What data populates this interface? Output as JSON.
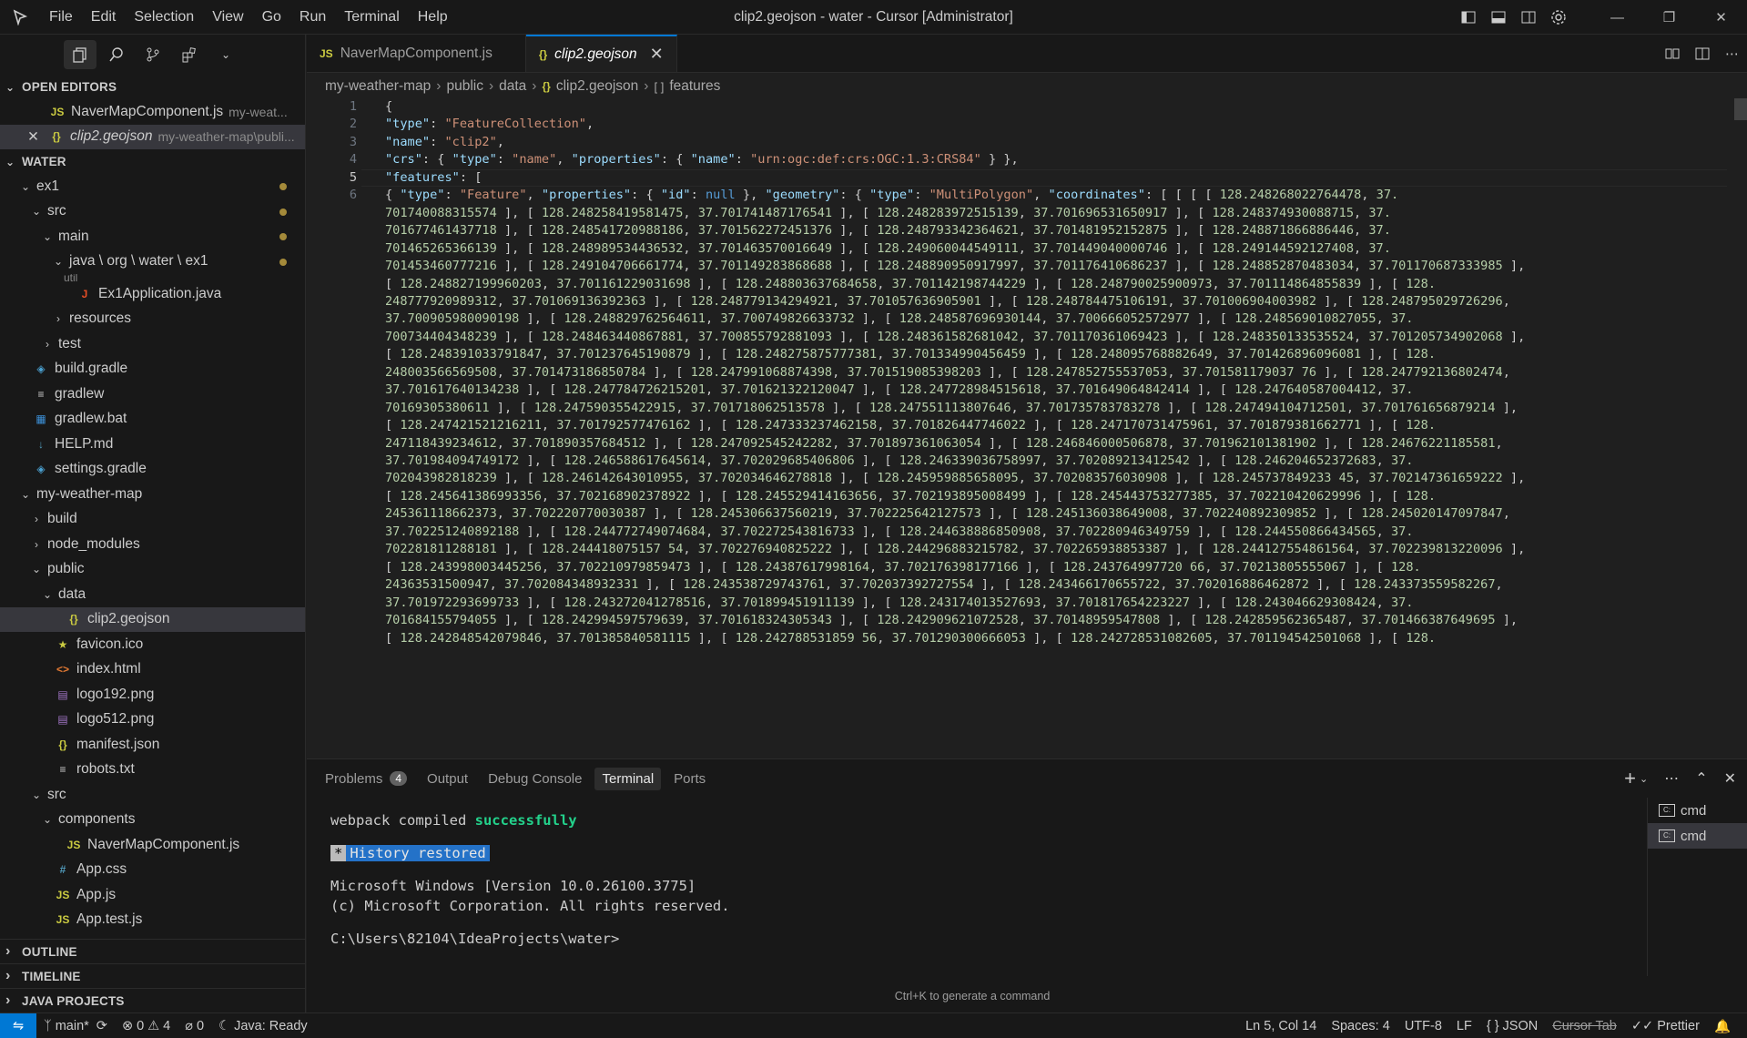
{
  "window": {
    "title": "clip2.geojson - water - Cursor [Administrator]",
    "menu": [
      "File",
      "Edit",
      "Selection",
      "View",
      "Go",
      "Run",
      "Terminal",
      "Help"
    ]
  },
  "sidebar": {
    "open_editors_title": "OPEN EDITORS",
    "open_editors": [
      {
        "icon": "JS",
        "name": "NaverMapComponent.js",
        "desc": "my-weat..."
      },
      {
        "icon": "{}",
        "name": "clip2.geojson",
        "desc": "my-weather-map\\publi..."
      }
    ],
    "workspace_title": "WATER",
    "tree": [
      {
        "label": "ex1",
        "depth": 1,
        "twisty": "open",
        "icon": "",
        "modified": true
      },
      {
        "label": "src",
        "depth": 2,
        "twisty": "open",
        "icon": "",
        "modified": true
      },
      {
        "label": "main",
        "depth": 3,
        "twisty": "open",
        "icon": "",
        "modified": true
      },
      {
        "label": "java \\ org \\ water \\ ex1",
        "depth": 4,
        "twisty": "open",
        "icon": "",
        "modified": true
      },
      {
        "label": "Ex1Application.java",
        "depth": 5,
        "twisty": "",
        "icon": "J",
        "modified": false
      },
      {
        "label": "resources",
        "depth": 4,
        "twisty": "closed",
        "icon": "",
        "modified": false
      },
      {
        "label": "test",
        "depth": 3,
        "twisty": "closed",
        "icon": "",
        "modified": false
      },
      {
        "label": "build.gradle",
        "depth": 1,
        "twisty": "",
        "icon": "gradle",
        "modified": false
      },
      {
        "label": "gradlew",
        "depth": 1,
        "twisty": "",
        "icon": "lines",
        "modified": false
      },
      {
        "label": "gradlew.bat",
        "depth": 1,
        "twisty": "",
        "icon": "win",
        "modified": false
      },
      {
        "label": "HELP.md",
        "depth": 1,
        "twisty": "",
        "icon": "md",
        "modified": false
      },
      {
        "label": "settings.gradle",
        "depth": 1,
        "twisty": "",
        "icon": "gradle",
        "modified": false
      },
      {
        "label": "my-weather-map",
        "depth": 1,
        "twisty": "open",
        "icon": "",
        "modified": false
      },
      {
        "label": "build",
        "depth": 2,
        "twisty": "closed",
        "icon": "",
        "modified": false
      },
      {
        "label": "node_modules",
        "depth": 2,
        "twisty": "closed",
        "icon": "",
        "modified": false
      },
      {
        "label": "public",
        "depth": 2,
        "twisty": "open",
        "icon": "",
        "modified": false
      },
      {
        "label": "data",
        "depth": 3,
        "twisty": "open",
        "icon": "",
        "modified": false
      },
      {
        "label": "clip2.geojson",
        "depth": 4,
        "twisty": "",
        "icon": "{}",
        "modified": false,
        "selected": true
      },
      {
        "label": "favicon.ico",
        "depth": 3,
        "twisty": "",
        "icon": "star",
        "modified": false
      },
      {
        "label": "index.html",
        "depth": 3,
        "twisty": "",
        "icon": "html",
        "modified": false
      },
      {
        "label": "logo192.png",
        "depth": 3,
        "twisty": "",
        "icon": "img",
        "modified": false
      },
      {
        "label": "logo512.png",
        "depth": 3,
        "twisty": "",
        "icon": "img",
        "modified": false
      },
      {
        "label": "manifest.json",
        "depth": 3,
        "twisty": "",
        "icon": "{}",
        "modified": false
      },
      {
        "label": "robots.txt",
        "depth": 3,
        "twisty": "",
        "icon": "lines",
        "modified": false
      },
      {
        "label": "src",
        "depth": 2,
        "twisty": "open",
        "icon": "",
        "modified": false
      },
      {
        "label": "components",
        "depth": 3,
        "twisty": "open",
        "icon": "",
        "modified": false
      },
      {
        "label": "NaverMapComponent.js",
        "depth": 4,
        "twisty": "",
        "icon": "JS",
        "modified": false
      },
      {
        "label": "App.css",
        "depth": 3,
        "twisty": "",
        "icon": "#",
        "modified": false
      },
      {
        "label": "App.js",
        "depth": 3,
        "twisty": "",
        "icon": "JS",
        "modified": false
      },
      {
        "label": "App.test.js",
        "depth": 3,
        "twisty": "",
        "icon": "JS",
        "modified": false
      }
    ],
    "sticky_partial": "util",
    "bottom_sections": [
      "OUTLINE",
      "TIMELINE",
      "JAVA PROJECTS"
    ]
  },
  "tabs": [
    {
      "icon": "JS",
      "label": "NaverMapComponent.js",
      "active": false
    },
    {
      "icon": "{}",
      "label": "clip2.geojson",
      "active": true
    }
  ],
  "breadcrumbs": [
    "my-weather-map",
    "public",
    "data",
    "clip2.geojson",
    "features"
  ],
  "editor": {
    "line_numbers": [
      "1",
      "2",
      "3",
      "4",
      "5",
      "6"
    ],
    "current_line": "5",
    "lines": [
      "{",
      "\"type\": \"FeatureCollection\",",
      "\"name\": \"clip2\",",
      "\"crs\": { \"type\": \"name\", \"properties\": { \"name\": \"urn:ogc:def:crs:OGC:1.3:CRS84\" } },",
      "\"features\": ["
    ],
    "line6_wrapped": [
      "{ \"type\": \"Feature\", \"properties\": { \"id\": null }, \"geometry\": { \"type\": \"MultiPolygon\", \"coordinates\": [ [ [ [ 128.248268022764478, 37.",
      "701740088315574 ], [ 128.248258419581475, 37.701741487176541 ], [ 128.248283972515139, 37.701696531650917 ], [ 128.248374930088715, 37.",
      "701677461437718 ], [ 128.248541720988186, 37.701562272451376 ], [ 128.248793342364621, 37.701481952152875 ], [ 128.248871866886446, 37.",
      "701465265366139 ], [ 128.248989534436532, 37.701463570016649 ], [ 128.249060044549111, 37.701449040000746 ], [ 128.249144592127408, 37.",
      "701453460777216 ], [ 128.249104706661774, 37.701149283868688 ], [ 128.248890950917997, 37.701176410686237 ], [ 128.248852870483034, 37.701170687333985 ],",
      "[ 128.248827199960203, 37.701161229031698 ], [ 128.248803637684658, 37.701142198744229 ], [ 128.248790025900973, 37.701114864855839 ], [ 128.",
      "248777920989312, 37.701069136392363 ], [ 128.248779134294921, 37.701057636905901 ], [ 128.248784475106191, 37.701006904003982 ], [ 128.248795029726296,",
      "37.700905980090198 ], [ 128.248829762564611, 37.700749826633732 ], [ 128.248587696930144, 37.700666052572977 ], [ 128.248569010827055, 37.",
      "700734404348239 ], [ 128.248463440867881, 37.700855792881093 ], [ 128.248361582681042, 37.701170361069423 ], [ 128.248350133535524, 37.701205734902068 ],",
      "[ 128.248391033791847, 37.701237645190879 ], [ 128.248275875777381, 37.701334990456459 ], [ 128.248095768882649, 37.701426896096081 ], [ 128.",
      "248003566569508, 37.701473186850784 ], [ 128.247991068874398, 37.701519085398203 ], [ 128.247852755537053, 37.701581179037 76 ], [ 128.247792136802474,",
      "37.701617640134238 ], [ 128.247784726215201, 37.701621322120047 ], [ 128.247728984515618, 37.701649064842414 ], [ 128.247640587004412, 37.",
      "70169305380611 ], [ 128.247590355422915, 37.701718062513578 ], [ 128.247551113807646, 37.701735783783278 ], [ 128.247494104712501, 37.701761656879214 ],",
      "[ 128.247421521216211, 37.701792577476162 ], [ 128.247333237462158, 37.701826447746022 ], [ 128.247170731475961, 37.701879381662771 ], [ 128.",
      "247118439234612, 37.701890357684512 ], [ 128.247092545242282, 37.701897361063054 ], [ 128.246846000506878, 37.701962101381902 ], [ 128.24676221185581,",
      "37.701984094749172 ], [ 128.246588617645614, 37.702029685406806 ], [ 128.246339036758997, 37.702089213412542 ], [ 128.246204652372683, 37.",
      "702043982818239 ], [ 128.246142643010955, 37.702034646278818 ], [ 128.245959885658095, 37.702083576030908 ], [ 128.245737849233 45, 37.702147361659222 ],",
      "[ 128.245641386993356, 37.702168902378922 ], [ 128.245529414163656, 37.702193895008499 ], [ 128.245443753277385, 37.702210420629996 ], [ 128.",
      "245361118662373, 37.702220770030387 ], [ 128.245306637560219, 37.702225642127573 ], [ 128.245136038649008, 37.702240892309852 ], [ 128.245020147097847,",
      "37.702251240892188 ], [ 128.244772749074684, 37.702272543816733 ], [ 128.244638886850908, 37.702280946349759 ], [ 128.244550866434565, 37.",
      "702281811288181 ], [ 128.244418075157 54, 37.702276940825222 ], [ 128.244296883215782, 37.702265938853387 ], [ 128.244127554861564, 37.702239813220096 ],",
      "[ 128.243998003445256, 37.702210979859473 ], [ 128.24387617998164, 37.702176398177166 ], [ 128.243764997720 66, 37.70213805555067 ], [ 128.",
      "24363531500947, 37.702084348932331 ], [ 128.243538729743761, 37.702037392727554 ], [ 128.243466170655722, 37.702016886462872 ], [ 128.243373559582267,",
      "37.701972293699733 ], [ 128.243272041278516, 37.701899451911139 ], [ 128.243174013527693, 37.701817654223227 ], [ 128.243046629308424, 37.",
      "701684155794055 ], [ 128.242994597579639, 37.701618324305343 ], [ 128.242909621072528, 37.70148959547808 ], [ 128.242859562365487, 37.701466387649695 ],",
      "[ 128.242848542079846, 37.701385840581115 ], [ 128.242788531859 56, 37.701290300666053 ], [ 128.242728531082605, 37.701194542501068 ], [ 128."
    ]
  },
  "panel": {
    "tabs": [
      {
        "label": "Problems",
        "badge": "4",
        "active": false
      },
      {
        "label": "Output",
        "active": false
      },
      {
        "label": "Debug Console",
        "active": false
      },
      {
        "label": "Terminal",
        "active": true
      },
      {
        "label": "Ports",
        "active": false
      }
    ],
    "terminal": {
      "webpack_prefix": "webpack compiled ",
      "webpack_status": "successfully",
      "history_star": "*",
      "history": "History restored",
      "line_ms1": "Microsoft Windows [Version 10.0.26100.3775]",
      "line_ms2": "(c) Microsoft Corporation. All rights reserved.",
      "prompt": "C:\\Users\\82104\\IdeaProjects\\water>",
      "hint": "Ctrl+K to generate a command"
    },
    "terminal_list": [
      "cmd",
      "cmd"
    ]
  },
  "statusbar": {
    "branch": "main*",
    "errors": "0",
    "warnings": "4",
    "ports": "0",
    "java": "Java: Ready",
    "position": "Ln 5, Col 14",
    "spaces": "Spaces: 4",
    "encoding": "UTF-8",
    "eol": "LF",
    "language": "JSON",
    "cursor_tab": "Cursor Tab",
    "prettier": "Prettier"
  },
  "colors": {
    "accent": "#0078d4",
    "modified_dot": "#a48a3a",
    "js_icon": "#cbcb41",
    "json_icon": "#cbcb41",
    "java_icon": "#e44d26"
  }
}
